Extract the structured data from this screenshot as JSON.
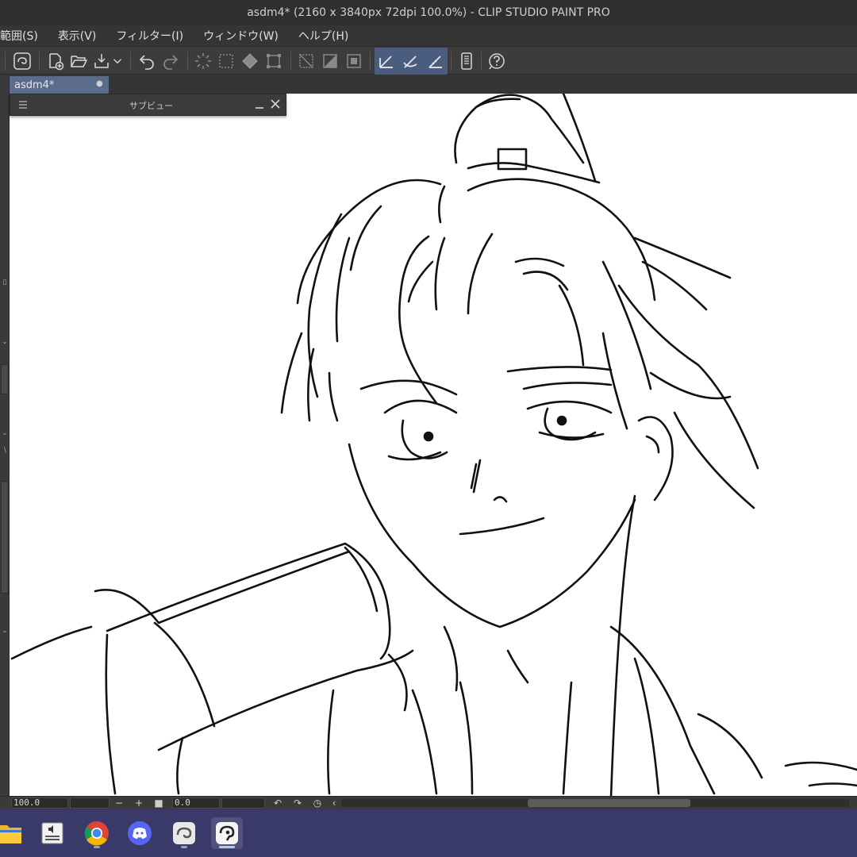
{
  "window": {
    "title": "asdm4* (2160 x 3840px 72dpi 100.0%)  - CLIP STUDIO PAINT PRO"
  },
  "menu": {
    "items": [
      {
        "label": "範囲(S)"
      },
      {
        "label": "表示(V)"
      },
      {
        "label": "フィルター(I)"
      },
      {
        "label": "ウィンドウ(W)"
      },
      {
        "label": "ヘルプ(H)"
      }
    ]
  },
  "toolbar": {
    "icons": [
      "clip-studio-icon",
      "new-canvas-icon",
      "open-folder-icon",
      "export-icon",
      "chevron-down-icon",
      "undo-icon",
      "redo-icon",
      "loading-spinner-icon",
      "select-all-icon",
      "fill-icon",
      "transform-icon",
      "hatch-icon",
      "pattern-icon",
      "border-icon",
      "ruler-pen-icon",
      "snap-icon",
      "ruler-settings-icon",
      "smartphone-icon",
      "help-icon"
    ]
  },
  "document": {
    "tab_label": "asdm4*"
  },
  "subview": {
    "title": "サブビュー"
  },
  "statusbar": {
    "zoom": "100.0",
    "angle": "0.0"
  },
  "taskbar": {
    "icons": [
      "file-explorer-icon",
      "audio-app-icon",
      "chrome-icon",
      "discord-icon",
      "clip-studio-icon",
      "clip-studio-paint-icon"
    ]
  },
  "colors": {
    "ui_dark": "#3a3a3a",
    "accent": "#5a6b8c",
    "taskbar": "#3a3a6a",
    "canvas": "#ffffff",
    "ink": "#111111"
  }
}
